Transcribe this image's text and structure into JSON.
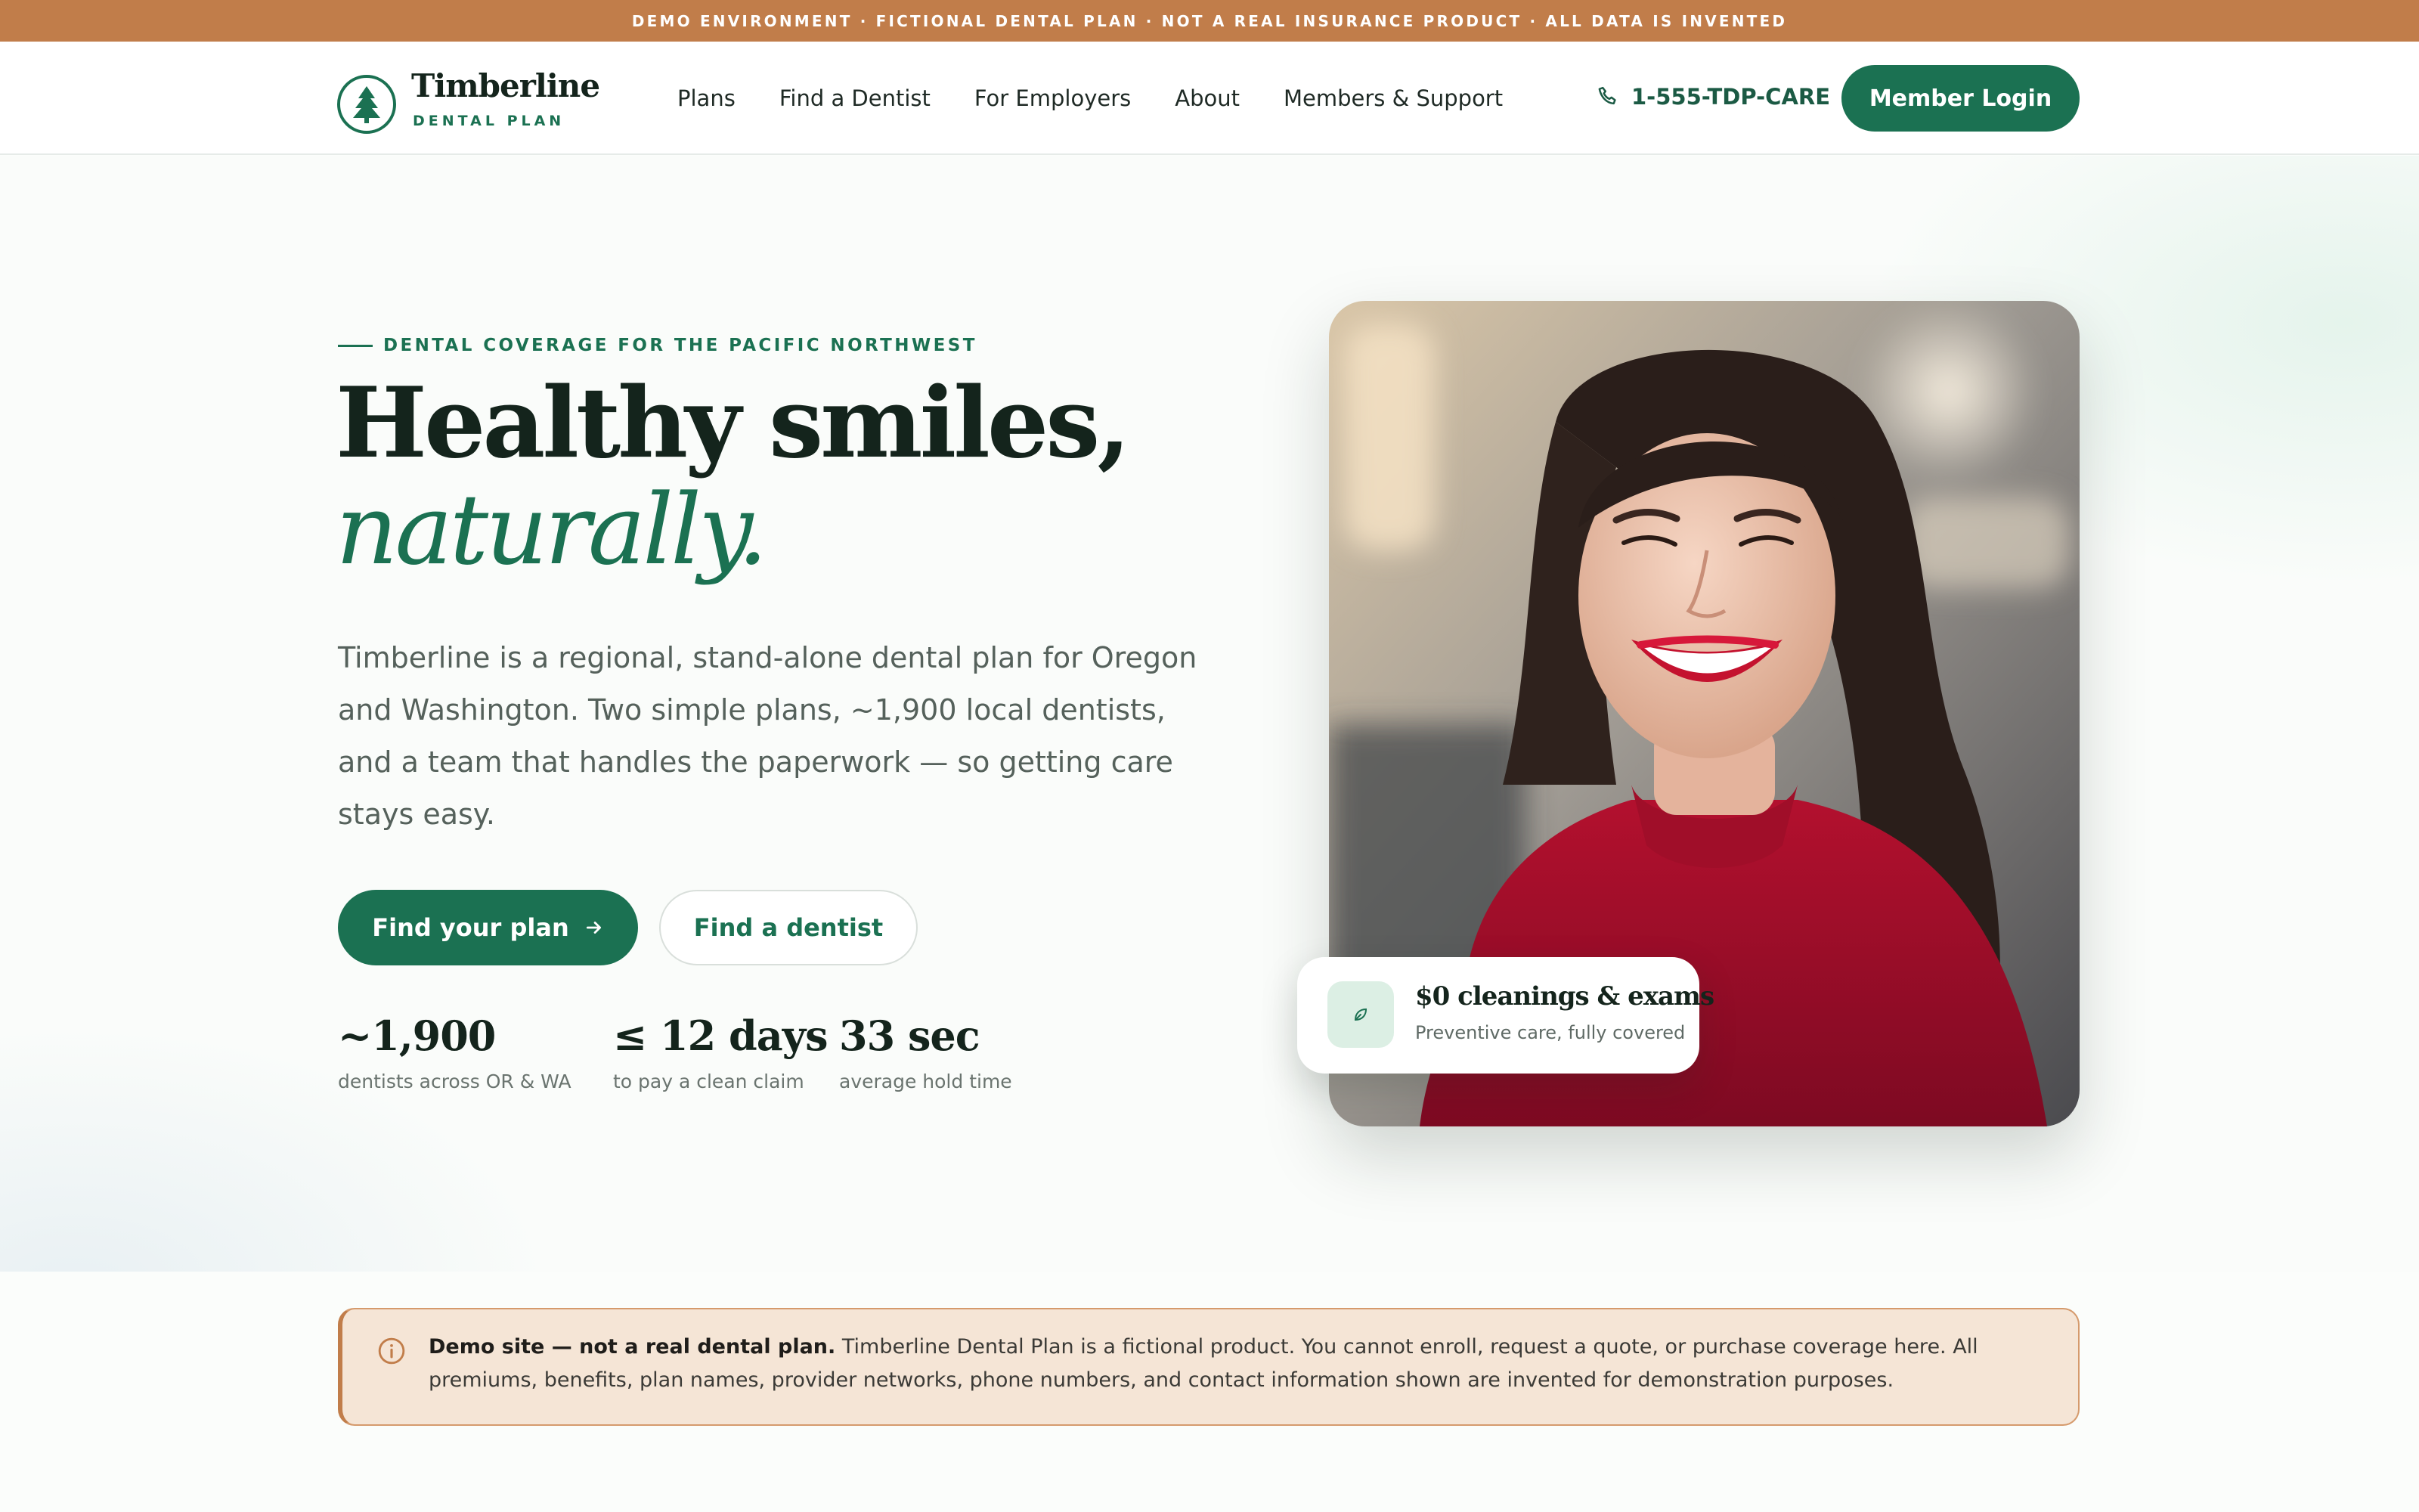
{
  "demo_banner": "DEMO ENVIRONMENT · FICTIONAL DENTAL PLAN · NOT A REAL INSURANCE PRODUCT · ALL DATA IS INVENTED",
  "brand": {
    "name": "Timberline",
    "subtitle": "DENTAL PLAN",
    "logo_icon": "pine-tree-icon",
    "primary_color": "#1b7152",
    "accent_color": "#c17d4a"
  },
  "nav": {
    "links": [
      "Plans",
      "Find a Dentist",
      "For Employers",
      "About",
      "Members & Support"
    ],
    "phone": "1-555-TDP-CARE",
    "phone_icon": "phone-icon",
    "login_label": "Member Login"
  },
  "hero": {
    "eyebrow": "DENTAL COVERAGE FOR THE PACIFIC NORTHWEST",
    "title_line1": "Healthy smiles,",
    "title_line2": "naturally.",
    "lead": "Timberline is a regional, stand-alone dental plan for Oregon and Washington. Two simple plans, ~1,900 local dentists, and a team that handles the paperwork — so getting care stays easy.",
    "primary_cta": "Find your plan",
    "secondary_cta": "Find a dentist",
    "stats": [
      {
        "value": "~1,900",
        "label": "dentists across OR & WA"
      },
      {
        "value": "≤ 12 days",
        "label": "to pay a clean claim"
      },
      {
        "value": "33 sec",
        "label": "average hold time"
      }
    ],
    "photo_alt": "smiling woman in red sweater",
    "badge": {
      "title": "$0 cleanings & exams",
      "subtitle": "Preventive care, fully covered",
      "icon": "leaf-icon"
    }
  },
  "notice": {
    "icon": "info-icon",
    "bold": "Demo site — not a real dental plan.",
    "text": " Timberline Dental Plan is a fictional product. You cannot enroll, request a quote, or purchase coverage here. All premiums, benefits, plan names, provider networks, phone numbers, and contact information shown are invented for demonstration purposes."
  }
}
